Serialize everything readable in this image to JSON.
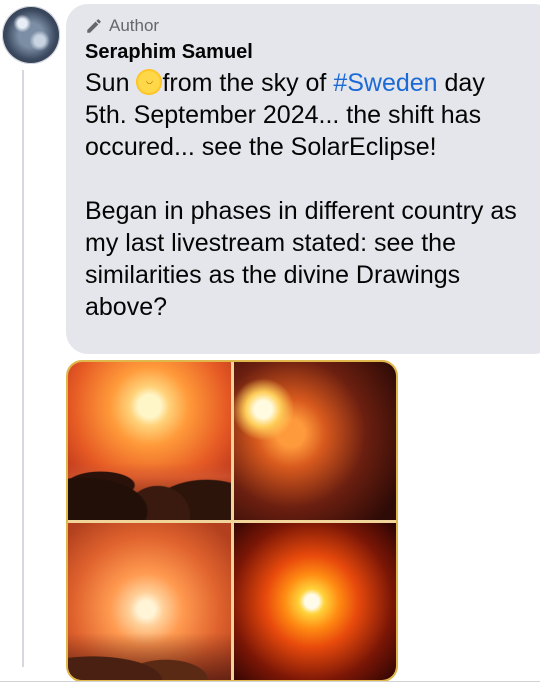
{
  "post": {
    "badge_label": "Author",
    "author_name": "Seraphim Samuel",
    "text": {
      "part1": "Sun ",
      "part2": "from the sky of ",
      "hashtag": "#Sweden",
      "part3": " day 5th. September 2024... the shift has occured... see the SolarEclipse!",
      "paragraph2": " Began in phases in different country as my last livestream stated: see the similarities as the divine Drawings above?"
    }
  },
  "icons": {
    "badge": "pencil-icon",
    "emoji": "sun-with-face-emoji"
  },
  "colors": {
    "bubble": "#e4e6eb",
    "hashtag": "#1b6ad6",
    "secondary_text": "#65676b"
  }
}
